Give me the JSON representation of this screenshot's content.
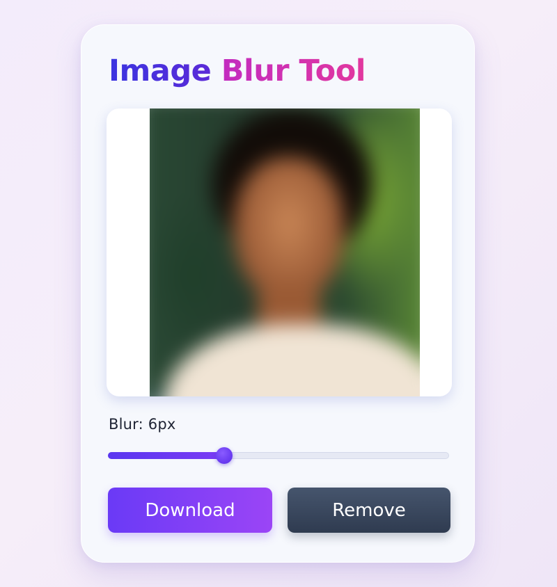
{
  "app": {
    "title_part1": "Image",
    "title_part2": "Blur Tool"
  },
  "preview": {
    "image_description_icon": "photo-preview"
  },
  "blur": {
    "label": "Blur: 6px",
    "value": 6,
    "fraction": 0.34
  },
  "actions": {
    "download_label": "Download",
    "remove_label": "Remove"
  },
  "colors": {
    "accent": "#6a3af6",
    "title_blue": "#3b35e0",
    "title_pink": "#e2389e",
    "remove_bg": "#3a475e"
  }
}
